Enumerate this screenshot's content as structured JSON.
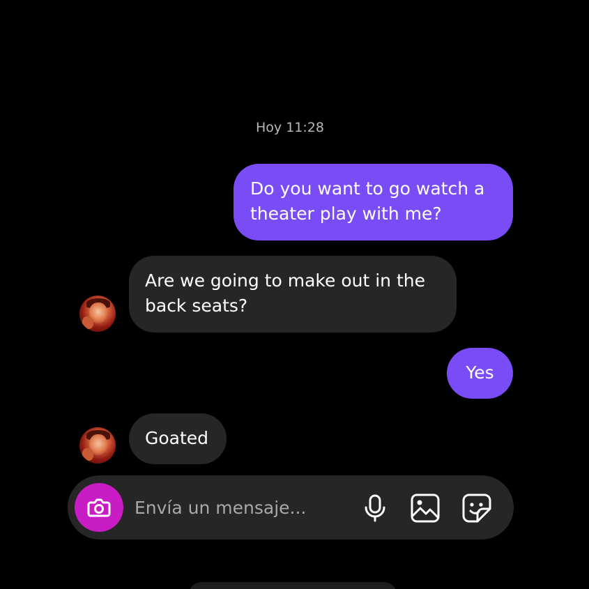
{
  "conversation": {
    "timestamp": "Hoy 11:28",
    "messages": [
      {
        "sender": "me",
        "text": "Do you want to go watch a\ntheater play with me?"
      },
      {
        "sender": "them",
        "text": "Are we going to make out in the\nback seats?"
      },
      {
        "sender": "me",
        "text": "Yes"
      },
      {
        "sender": "them",
        "text": "Goated"
      }
    ]
  },
  "composer": {
    "placeholder": "Envía un mensaje...",
    "camera_icon": "camera-icon",
    "mic_icon": "microphone-icon",
    "gallery_icon": "image-gallery-icon",
    "sticker_icon": "sticker-icon"
  },
  "colors": {
    "sent_bubble": "#7a4cf5",
    "received_bubble": "#262626",
    "camera_button": "#c81cc4",
    "background": "#000000"
  }
}
